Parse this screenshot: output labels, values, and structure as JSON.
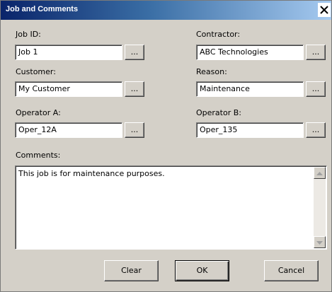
{
  "window": {
    "title": "Job and Comments",
    "close_glyph": "✕"
  },
  "fields": {
    "job_id": {
      "label": "Job ID:",
      "value": "Job 1"
    },
    "contractor": {
      "label": "Contractor:",
      "value": "ABC Technologies"
    },
    "customer": {
      "label": "Customer:",
      "value": "My Customer"
    },
    "reason": {
      "label": "Reason:",
      "value": "Maintenance"
    },
    "operator_a": {
      "label": "Operator A:",
      "value": "Oper_12A"
    },
    "operator_b": {
      "label": "Operator B:",
      "value": "Oper_135"
    }
  },
  "browse_label": "...",
  "comments": {
    "label": "Comments:",
    "value": "This job is for maintenance purposes."
  },
  "buttons": {
    "clear": "Clear",
    "ok": "OK",
    "cancel": "Cancel"
  },
  "icons": {
    "close": "close-icon",
    "scroll_up": "arrow-up-icon",
    "scroll_down": "arrow-down-icon"
  }
}
